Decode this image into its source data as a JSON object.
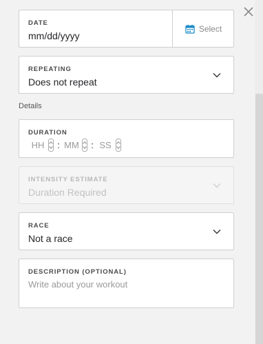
{
  "window": {
    "close_icon": "close-icon"
  },
  "date": {
    "label": "DATE",
    "value": "mm/dd/yyyy",
    "select_label": "Select",
    "icon": "calendar-icon"
  },
  "repeating": {
    "label": "REPEATING",
    "value": "Does not repeat",
    "icon": "chevron-down-icon"
  },
  "details_label": "Details",
  "duration": {
    "label": "DURATION",
    "hours_placeholder": "HH",
    "minutes_placeholder": "MM",
    "seconds_placeholder": "SS",
    "separator": ":"
  },
  "intensity": {
    "label": "INTENSITY ESTIMATE",
    "value": "Duration Required",
    "disabled": true
  },
  "race": {
    "label": "RACE",
    "value": "Not a race",
    "icon": "chevron-down-icon"
  },
  "description": {
    "label": "DESCRIPTION (OPTIONAL)",
    "placeholder": "Write about your workout"
  },
  "colors": {
    "accent": "#1a8bc7",
    "background": "#f2f2f2",
    "border": "#cfcfcf",
    "text": "#242428",
    "muted": "#9a9a9a"
  }
}
